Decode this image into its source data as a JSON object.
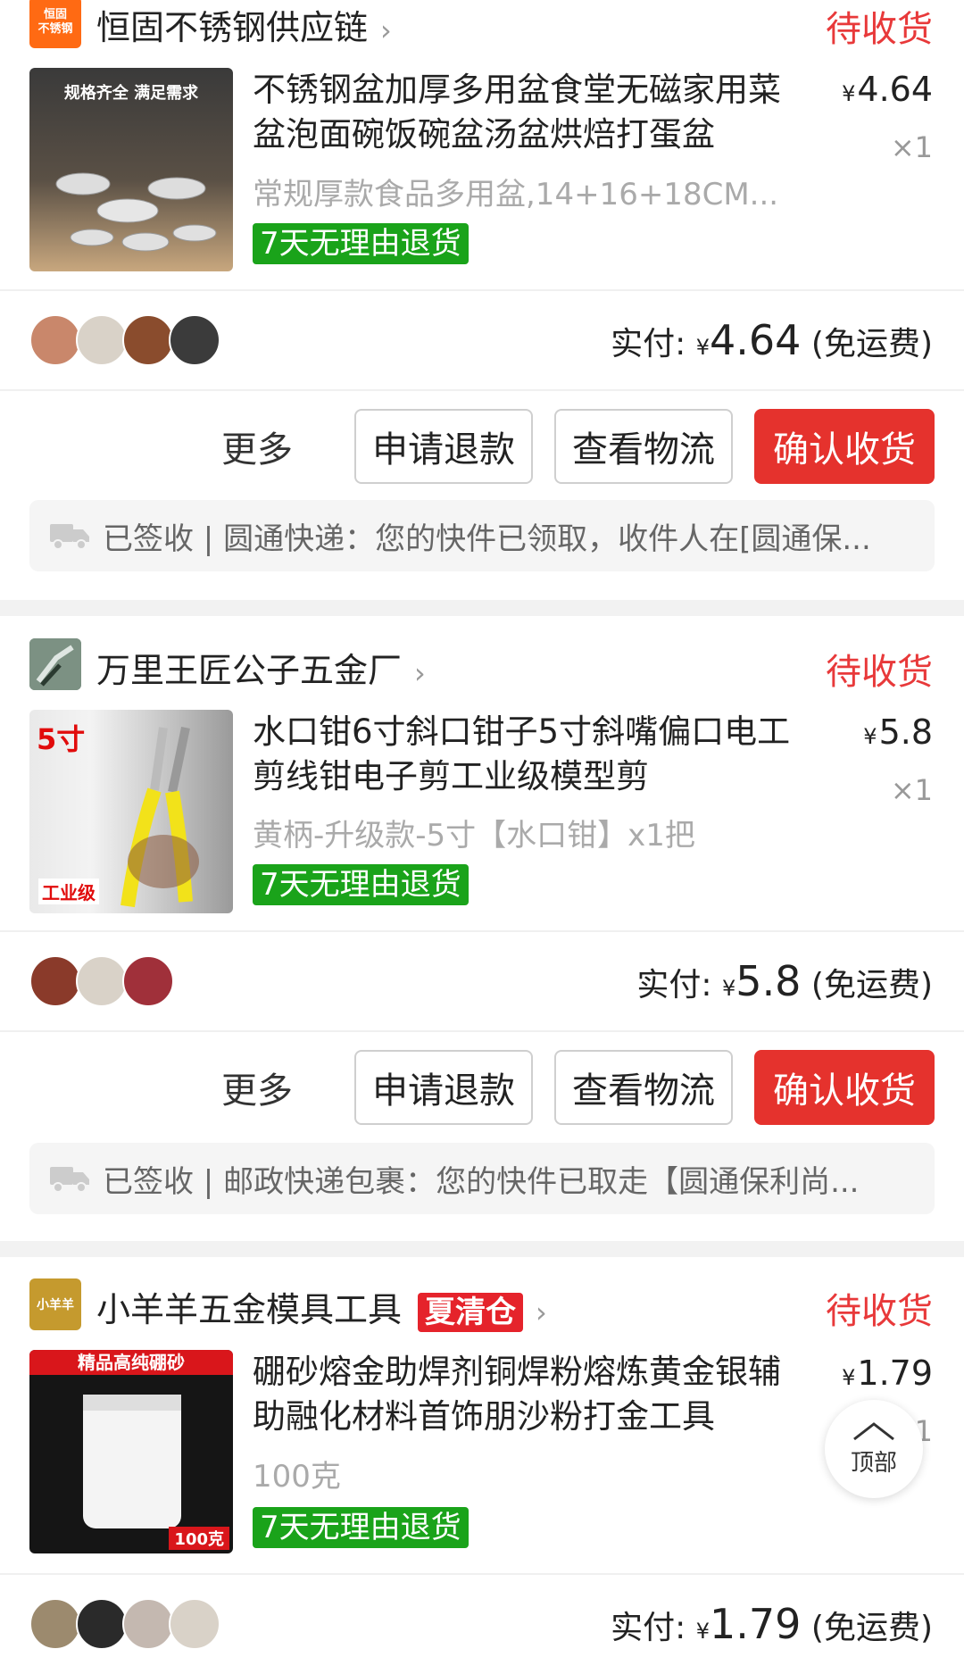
{
  "orders": [
    {
      "shop": {
        "logo_text": "恒固\n不锈钢",
        "name": "恒固不锈钢供应链",
        "badge": ""
      },
      "status": "待收货",
      "product": {
        "thumb_caption": "规格齐全 满足需求",
        "title": "不锈钢盆加厚多用盆食堂无磁家用菜盆泡面碗饭碗盆汤盆烘焙打蛋盆",
        "spec": "常规厚款食品多用盆,14+16+18CM...",
        "tag": "7天无理由退货",
        "price": "4.64",
        "qty": "×1"
      },
      "paid_label": "实付:",
      "paid_amount": "4.64",
      "shipping_note": "(免运费)",
      "actions": {
        "more": "更多",
        "refund": "申请退款",
        "logistics": "查看物流",
        "confirm": "确认收货"
      },
      "logistics_text": "已签收 | 圆通快递：您的快件已领取，收件人在[圆通保..."
    },
    {
      "shop": {
        "logo_text": "",
        "name": "万里王匠公子五金厂",
        "badge": ""
      },
      "status": "待收货",
      "product": {
        "thumb_caption": "5寸",
        "thumb_footer": "工业级",
        "title": "水口钳6寸斜口钳子5寸斜嘴偏口电工剪线钳电子剪工业级模型剪",
        "spec": "黄柄-升级款-5寸【水口钳】x1把",
        "tag": "7天无理由退货",
        "price": "5.8",
        "qty": "×1"
      },
      "paid_label": "实付:",
      "paid_amount": "5.8",
      "shipping_note": "(免运费)",
      "actions": {
        "more": "更多",
        "refund": "申请退款",
        "logistics": "查看物流",
        "confirm": "确认收货"
      },
      "logistics_text": "已签收 | 邮政快递包裹：您的快件已取走【圆通保利尚..."
    },
    {
      "shop": {
        "logo_text": "小羊羊",
        "name": "小羊羊五金模具工具",
        "badge": "夏清仓"
      },
      "status": "待收货",
      "product": {
        "thumb_caption": "精品高纯硼砂",
        "thumb_footer": "100克",
        "title": "硼砂熔金助焊剂铜焊粉熔炼黄金银辅助融化材料首饰朋沙粉打金工具",
        "spec": "100克",
        "tag": "7天无理由退货",
        "price": "1.79",
        "qty": "×1"
      },
      "paid_label": "实付:",
      "paid_amount": "1.79",
      "shipping_note": "(免运费)"
    }
  ],
  "currency_symbol": "¥",
  "back_to_top": "顶部",
  "colors": {
    "accent": "#e8393a",
    "tag_green": "#1aa31a",
    "primary_button": "#e5322d"
  }
}
